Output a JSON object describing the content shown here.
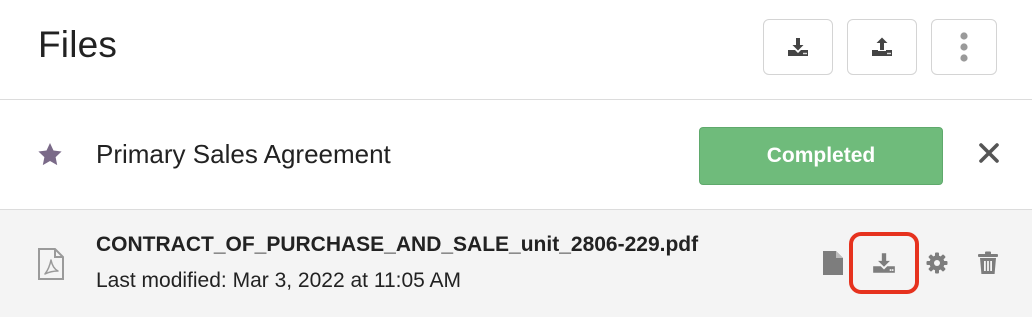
{
  "header": {
    "title": "Files",
    "actions": [
      {
        "icon": "download-icon"
      },
      {
        "icon": "upload-icon"
      },
      {
        "icon": "more-vertical-icon"
      }
    ]
  },
  "agreement": {
    "name": "Primary Sales Agreement",
    "favorite_icon": "star-icon",
    "status": "Completed",
    "status_color": "#6fbb7b",
    "close_icon": "close-icon"
  },
  "file": {
    "name": "CONTRACT_OF_PURCHASE_AND_SALE_unit_2806-229.pdf",
    "last_modified": "Last modified: Mar 3, 2022 at 11:05 AM",
    "type_icon": "pdf-file-icon",
    "actions": [
      {
        "icon": "document-icon"
      },
      {
        "icon": "download-icon",
        "highlighted": true
      },
      {
        "icon": "gear-icon"
      },
      {
        "icon": "trash-icon"
      }
    ]
  },
  "colors": {
    "icon": "#4a4a4a",
    "muted_icon": "#8a8a8a",
    "star": "#7a6a88",
    "highlight": "#e6321e"
  }
}
